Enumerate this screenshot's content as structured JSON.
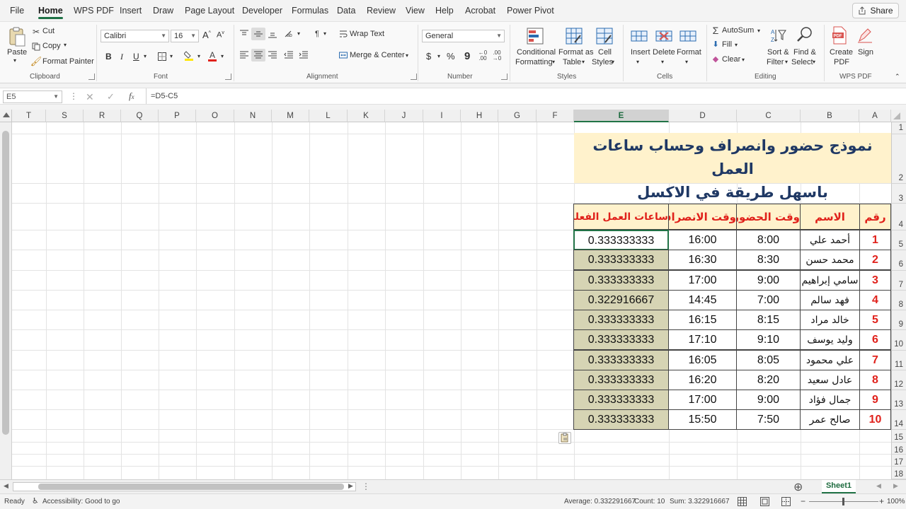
{
  "menu": {
    "items": [
      "File",
      "Home",
      "WPS PDF",
      "Insert",
      "Draw",
      "Page Layout",
      "Developer",
      "Formulas",
      "Data",
      "Review",
      "View",
      "Help",
      "Acrobat",
      "Power Pivot"
    ],
    "active": "Home",
    "share_label": "Share"
  },
  "ribbon": {
    "clipboard": {
      "paste": "Paste",
      "cut": "Cut",
      "copy": "Copy",
      "format_painter": "Format Painter",
      "label": "Clipboard"
    },
    "font": {
      "name": "Calibri",
      "size": "16",
      "label": "Font",
      "bold": "B",
      "italic": "I",
      "underline": "U"
    },
    "alignment": {
      "wrap_text": "Wrap Text",
      "merge_center": "Merge & Center",
      "label": "Alignment"
    },
    "number": {
      "format": "General",
      "currency": "$",
      "percent": "%",
      "comma": "9",
      "label": "Number"
    },
    "styles": {
      "conditional": "Conditional",
      "formatting": "Formatting",
      "format_as": "Format as",
      "table": "Table",
      "cell": "Cell",
      "cell_styles": "Styles",
      "label": "Styles"
    },
    "cells": {
      "insert": "Insert",
      "delete": "Delete",
      "format": "Format",
      "label": "Cells"
    },
    "editing": {
      "autosum": "AutoSum",
      "fill": "Fill",
      "clear": "Clear",
      "sort": "Sort &",
      "filter": "Filter",
      "find": "Find &",
      "select": "Select",
      "label": "Editing"
    },
    "wps": {
      "create": "Create",
      "pdf": "PDF",
      "sign": "Sign",
      "label": "WPS PDF"
    }
  },
  "formula_bar": {
    "name_box": "E5",
    "formula": "=D5-C5"
  },
  "columns": [
    "T",
    "S",
    "R",
    "Q",
    "P",
    "O",
    "N",
    "M",
    "L",
    "K",
    "J",
    "I",
    "H",
    "G",
    "F",
    "E",
    "D",
    "C",
    "B",
    "A"
  ],
  "rows": [
    "1",
    "2",
    "3",
    "4",
    "5",
    "6",
    "7",
    "8",
    "9",
    "10",
    "11",
    "12",
    "13",
    "14",
    "15",
    "16",
    "17",
    "18"
  ],
  "sheet": {
    "title_line1": "نموذج حضور وانصراف وحساب ساعات العمل",
    "title_line2": "باسهل طريقة في الاكسل",
    "headers": {
      "num": "رقم",
      "name": "الاسم",
      "in": "وقت الحضور",
      "out": "وقت الانصراف",
      "hours": "ساعات العمل الفعلية"
    },
    "records": [
      {
        "num": "1",
        "name": "أحمد علي",
        "in": "8:00",
        "out": "16:00",
        "hours": "0.333333333"
      },
      {
        "num": "2",
        "name": "محمد حسن",
        "in": "8:30",
        "out": "16:30",
        "hours": "0.333333333"
      },
      {
        "num": "3",
        "name": "سامي إبراهيم",
        "in": "9:00",
        "out": "17:00",
        "hours": "0.333333333"
      },
      {
        "num": "4",
        "name": "فهد سالم",
        "in": "7:00",
        "out": "14:45",
        "hours": "0.322916667"
      },
      {
        "num": "5",
        "name": "خالد مراد",
        "in": "8:15",
        "out": "16:15",
        "hours": "0.333333333"
      },
      {
        "num": "6",
        "name": "وليد يوسف",
        "in": "9:10",
        "out": "17:10",
        "hours": "0.333333333"
      },
      {
        "num": "7",
        "name": "علي محمود",
        "in": "8:05",
        "out": "16:05",
        "hours": "0.333333333"
      },
      {
        "num": "8",
        "name": "عادل سعيد",
        "in": "8:20",
        "out": "16:20",
        "hours": "0.333333333"
      },
      {
        "num": "9",
        "name": "جمال فؤاد",
        "in": "9:00",
        "out": "17:00",
        "hours": "0.333333333"
      },
      {
        "num": "10",
        "name": "صالح عمر",
        "in": "7:50",
        "out": "15:50",
        "hours": "0.333333333"
      }
    ]
  },
  "sheet_tab": "Sheet1",
  "status": {
    "ready": "Ready",
    "accessibility": "Accessibility: Good to go",
    "average": "Average: 0.332291667",
    "count": "Count: 10",
    "sum": "Sum: 3.322916667",
    "zoom": "100%"
  }
}
